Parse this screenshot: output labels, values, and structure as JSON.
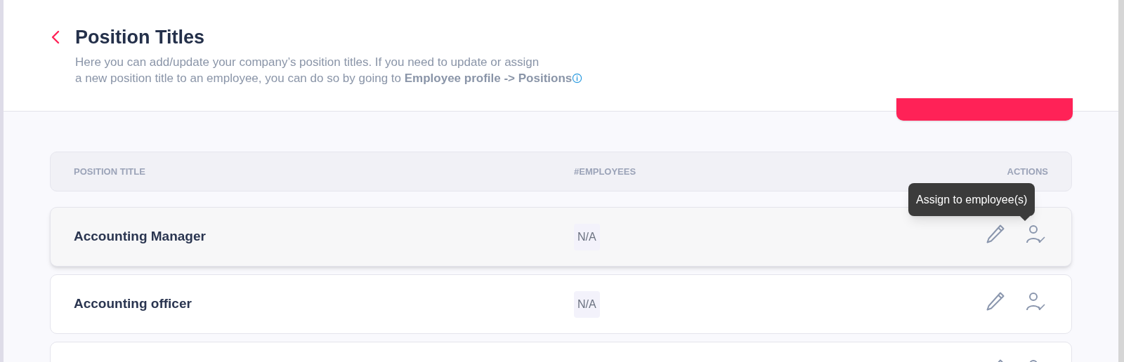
{
  "header": {
    "title": "Position Titles",
    "description": "Here you can add/update your company’s position titles. If you need to update or assign\na new position title to an employee, you can do so by going to **Employee profile -> Positions**"
  },
  "table": {
    "columns": [
      "POSITION TITLE",
      "#EMPLOYEES",
      "ACTIONS"
    ],
    "rows": [
      {
        "title": "Accounting Manager",
        "employees": "N/A",
        "hovered": true
      },
      {
        "title": "Accounting officer",
        "employees": "N/A",
        "hovered": false
      },
      {}
    ]
  },
  "tooltip": {
    "text": "Assign to employee(s)"
  }
}
